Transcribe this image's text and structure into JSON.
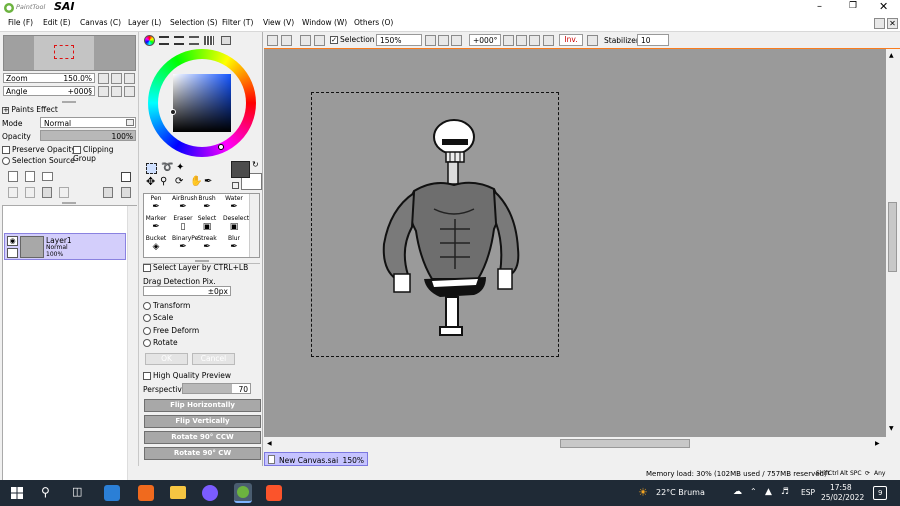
{
  "app": {
    "title_logo_text": "SAI",
    "title_small_text": "PaintTool"
  },
  "menu": [
    "File (F)",
    "Edit (E)",
    "Canvas (C)",
    "Layer (L)",
    "Selection (S)",
    "Filter (T)",
    "View (V)",
    "Window (W)",
    "Others (O)"
  ],
  "navigator": {
    "zoom_label": "Zoom",
    "zoom_value": "150.0%",
    "angle_label": "Angle",
    "angle_value": "+000§"
  },
  "paints_effect": {
    "header": "Paints Effect",
    "mode_label": "Mode",
    "mode_value": "Normal",
    "opacity_label": "Opacity",
    "opacity_value": "100%",
    "preserve_opacity": "Preserve Opacity",
    "clipping_group": "Clipping Group",
    "selection_source": "Selection Source"
  },
  "layer": {
    "name": "Layer1",
    "mode": "Normal",
    "opacity": "100%"
  },
  "tools": {
    "row1": [
      "Pen",
      "AirBrush",
      "Brush",
      "Water"
    ],
    "row2": [
      "Marker",
      "Eraser",
      "Select",
      "Deselect"
    ],
    "row3": [
      "Bucket",
      "BinaryPe",
      "Streak",
      "Blur"
    ]
  },
  "transform": {
    "select_layer_ctrl": "Select Layer by CTRL+LB",
    "drag_detection_label": "Drag Detection Pix.",
    "drag_detection_value": "±0px",
    "options": [
      "Transform",
      "Scale",
      "Free Deform",
      "Rotate"
    ],
    "ok": "OK",
    "cancel": "Cancel",
    "high_quality_preview": "High Quality Preview",
    "perspective_label": "Perspective",
    "perspective_value": "70",
    "buttons": [
      "Flip Horizontally",
      "Flip Vertically",
      "Rotate 90° CCW",
      "Rotate 90° CW"
    ]
  },
  "toolbar": {
    "selection_label": "Selection",
    "zoom_value": "150%",
    "angle_value": "+000°",
    "inv_label": "Inv.",
    "stabilizer_label": "Stabilizer",
    "stabilizer_value": "10"
  },
  "document_tab": {
    "name": "New Canvas.sai",
    "zoom": "150%"
  },
  "status": {
    "memory": "Memory load: 30% (102MB used / 757MB reserved)",
    "keys": [
      "Shift",
      "Ctrl",
      "Alt",
      "SPC"
    ],
    "any_label": "Any"
  },
  "taskbar": {
    "weather": "22°C  Bruma",
    "language": "ESP",
    "time": "17:58",
    "date": "25/02/2022",
    "notifications": "9"
  },
  "colors": {
    "primary": "#4c4c4c",
    "secondary": "#ffffff",
    "accent": "#f97c1e",
    "selection_outline": "#000000"
  }
}
